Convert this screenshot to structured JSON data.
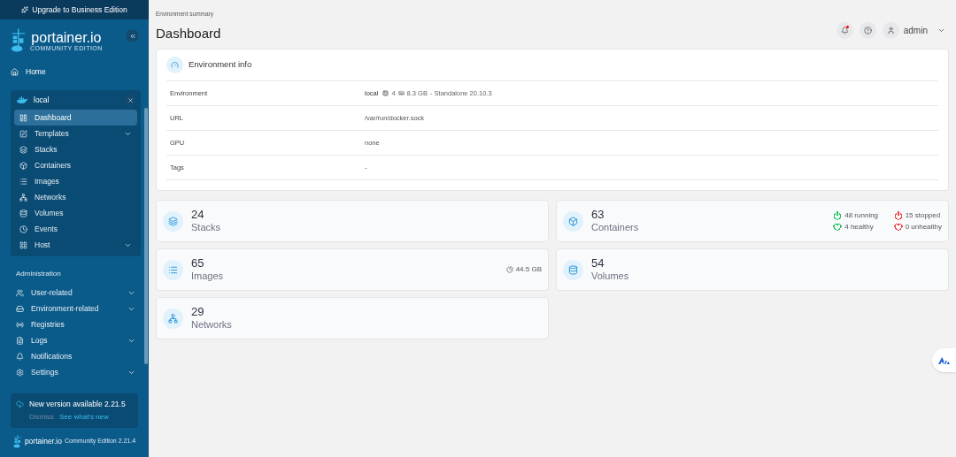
{
  "sidebar": {
    "upgrade_banner": "Upgrade to Business Edition",
    "brand": {
      "name": "portainer.io",
      "edition": "COMMUNITY EDITION"
    },
    "home": "Home",
    "environment": {
      "name": "local",
      "items": [
        {
          "label": "Dashboard",
          "selected": true
        },
        {
          "label": "Templates",
          "selected": false,
          "expanded": false
        },
        {
          "label": "Stacks",
          "selected": false
        },
        {
          "label": "Containers",
          "selected": false
        },
        {
          "label": "Images",
          "selected": false
        },
        {
          "label": "Networks",
          "selected": false
        },
        {
          "label": "Volumes",
          "selected": false
        },
        {
          "label": "Events",
          "selected": false
        },
        {
          "label": "Host",
          "selected": false,
          "expanded": false
        }
      ]
    },
    "administration": {
      "heading": "Administration",
      "items": [
        {
          "label": "User-related",
          "selected": false,
          "expanded": false
        },
        {
          "label": "Environment-related",
          "selected": false,
          "expanded": false
        },
        {
          "label": "Registries",
          "selected": false
        },
        {
          "label": "Logs",
          "selected": false,
          "expanded": false
        },
        {
          "label": "Notifications",
          "selected": false
        },
        {
          "label": "Settings",
          "selected": false,
          "expanded": false
        }
      ]
    },
    "update_notice": {
      "title": "New version available 2.21.5",
      "dismiss": "Dismiss",
      "link": "See what's new"
    },
    "footer": {
      "brand": "portainer.io",
      "edition": "Community Edition 2.21.4"
    }
  },
  "header": {
    "breadcrumb": "Environment summary",
    "title": "Dashboard",
    "notifications_unread": true,
    "user": "admin"
  },
  "environment_info": {
    "title": "Environment info",
    "rows": [
      {
        "kind": "environment",
        "label": "Environment",
        "name": "local",
        "cpus": "4",
        "memory": "8.3 GB",
        "details": "- Standalone 20.10.3"
      },
      {
        "kind": "text",
        "label": "URL",
        "value": "/var/run/docker.sock"
      },
      {
        "kind": "text",
        "label": "GPU",
        "value": "none"
      },
      {
        "kind": "text",
        "label": "Tags",
        "value": "-"
      }
    ]
  },
  "stats": [
    {
      "count": "24",
      "label": "Stacks"
    },
    {
      "count": "63",
      "label": "Containers",
      "badges": [
        {
          "text": "48 running",
          "color": "#22c55e",
          "kind": "power"
        },
        {
          "text": "15 stopped",
          "color": "#ef4444",
          "kind": "power"
        },
        {
          "text": "4 healthy",
          "color": "#22c55e",
          "kind": "heart"
        },
        {
          "text": "0 unhealthy",
          "color": "#ef4444",
          "kind": "heart"
        }
      ]
    },
    {
      "count": "65",
      "label": "Images",
      "size": "44.5 GB"
    },
    {
      "count": "54",
      "label": "Volumes"
    },
    {
      "count": "29",
      "label": "Networks"
    }
  ]
}
